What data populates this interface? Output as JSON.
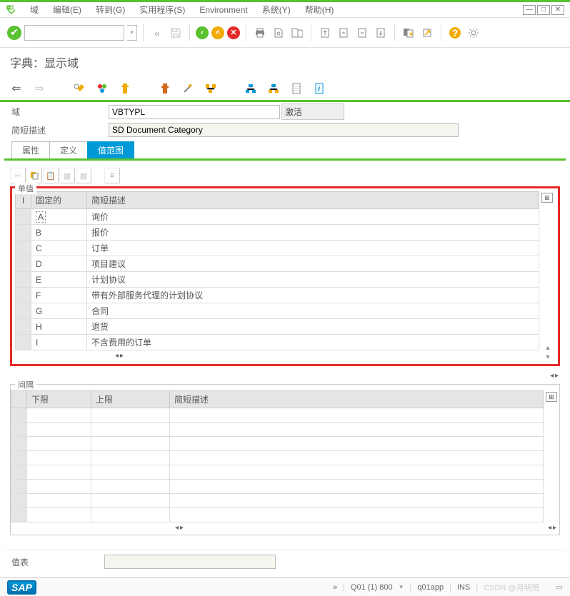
{
  "menu": {
    "items": [
      "域",
      "编辑(E)",
      "转到(G)",
      "实用程序(S)",
      "Environment",
      "系统(Y)",
      "帮助(H)"
    ]
  },
  "title": "字典：显示域",
  "fields": {
    "domain_label": "域",
    "domain_value": "VBTYPL",
    "status": "激活",
    "desc_label": "简短描述",
    "desc_value": "SD Document Category"
  },
  "tabs": [
    "属性",
    "定义",
    "值范围"
  ],
  "active_tab": 2,
  "single_values": {
    "title": "单值",
    "header_marker": "I",
    "col_fixed": "固定的",
    "col_desc": "简短描述",
    "rows": [
      {
        "fix": "A",
        "desc": "询价"
      },
      {
        "fix": "B",
        "desc": "报价"
      },
      {
        "fix": "C",
        "desc": "订单"
      },
      {
        "fix": "D",
        "desc": "项目建议"
      },
      {
        "fix": "E",
        "desc": "计划协议"
      },
      {
        "fix": "F",
        "desc": "带有外部服务代理的计划协议"
      },
      {
        "fix": "G",
        "desc": "合同"
      },
      {
        "fix": "H",
        "desc": "退货"
      },
      {
        "fix": "I",
        "desc": "不含费用的订单"
      }
    ]
  },
  "intervals": {
    "title": "间隔",
    "col_low": "下限",
    "col_high": "上限",
    "col_desc": "简短描述",
    "rows": [
      {},
      {},
      {},
      {},
      {},
      {},
      {},
      {}
    ]
  },
  "value_table": {
    "label": "值表",
    "value": ""
  },
  "status": {
    "system": "Q01 (1) 800",
    "server": "q01app",
    "mode": "INS",
    "watermark": "CSDN @月明荒"
  }
}
